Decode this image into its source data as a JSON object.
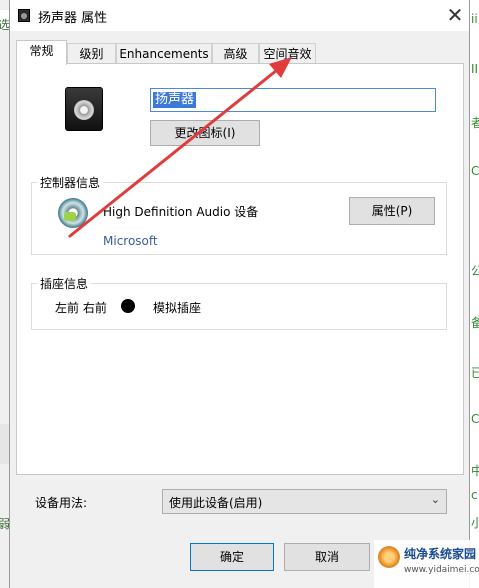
{
  "window": {
    "title": "扬声器 属性",
    "close_glyph": "✕"
  },
  "tabs": [
    {
      "label": "常规",
      "active": true
    },
    {
      "label": "级别"
    },
    {
      "label": "Enhancements"
    },
    {
      "label": "高级"
    },
    {
      "label": "空间音效"
    }
  ],
  "general": {
    "device_name": "扬声器",
    "change_icon_label": "更改图标(I)"
  },
  "controller": {
    "group_title": "控制器信息",
    "name": "High Definition Audio 设备",
    "vendor": "Microsoft",
    "properties_label": "属性(P)"
  },
  "jack": {
    "group_title": "插座信息",
    "position": "左前 右前",
    "type": "模拟插座",
    "color": "#000000"
  },
  "usage": {
    "label": "设备用法:",
    "selected": "使用此设备(启用)",
    "chevron_icon": "chevron-down-icon"
  },
  "footer": {
    "ok_label": "确定",
    "cancel_label": "取消"
  },
  "annotation": {
    "arrow_color": "#e03c3c"
  },
  "watermark": {
    "title": "纯净系统家园",
    "url": "www.yidaimei.com"
  },
  "background_window": {
    "left_chars": [
      "选",
      "弱"
    ],
    "right_chars": [
      "ii",
      "II",
      "者",
      "C",
      "公",
      "备",
      "已",
      "C",
      "中",
      "c",
      "小"
    ]
  }
}
